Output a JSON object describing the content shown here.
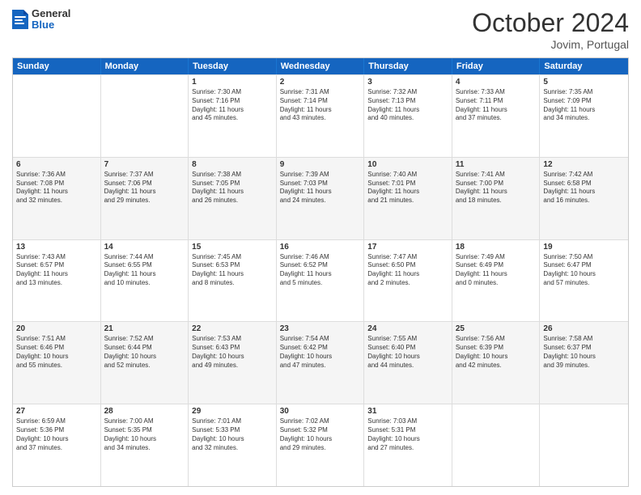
{
  "header": {
    "logo_general": "General",
    "logo_blue": "Blue",
    "month_title": "October 2024",
    "location": "Jovim, Portugal"
  },
  "weekdays": [
    "Sunday",
    "Monday",
    "Tuesday",
    "Wednesday",
    "Thursday",
    "Friday",
    "Saturday"
  ],
  "rows": [
    [
      {
        "day": "",
        "lines": [],
        "empty": true
      },
      {
        "day": "",
        "lines": [],
        "empty": true
      },
      {
        "day": "1",
        "lines": [
          "Sunrise: 7:30 AM",
          "Sunset: 7:16 PM",
          "Daylight: 11 hours",
          "and 45 minutes."
        ]
      },
      {
        "day": "2",
        "lines": [
          "Sunrise: 7:31 AM",
          "Sunset: 7:14 PM",
          "Daylight: 11 hours",
          "and 43 minutes."
        ]
      },
      {
        "day": "3",
        "lines": [
          "Sunrise: 7:32 AM",
          "Sunset: 7:13 PM",
          "Daylight: 11 hours",
          "and 40 minutes."
        ]
      },
      {
        "day": "4",
        "lines": [
          "Sunrise: 7:33 AM",
          "Sunset: 7:11 PM",
          "Daylight: 11 hours",
          "and 37 minutes."
        ]
      },
      {
        "day": "5",
        "lines": [
          "Sunrise: 7:35 AM",
          "Sunset: 7:09 PM",
          "Daylight: 11 hours",
          "and 34 minutes."
        ]
      }
    ],
    [
      {
        "day": "6",
        "lines": [
          "Sunrise: 7:36 AM",
          "Sunset: 7:08 PM",
          "Daylight: 11 hours",
          "and 32 minutes."
        ]
      },
      {
        "day": "7",
        "lines": [
          "Sunrise: 7:37 AM",
          "Sunset: 7:06 PM",
          "Daylight: 11 hours",
          "and 29 minutes."
        ]
      },
      {
        "day": "8",
        "lines": [
          "Sunrise: 7:38 AM",
          "Sunset: 7:05 PM",
          "Daylight: 11 hours",
          "and 26 minutes."
        ]
      },
      {
        "day": "9",
        "lines": [
          "Sunrise: 7:39 AM",
          "Sunset: 7:03 PM",
          "Daylight: 11 hours",
          "and 24 minutes."
        ]
      },
      {
        "day": "10",
        "lines": [
          "Sunrise: 7:40 AM",
          "Sunset: 7:01 PM",
          "Daylight: 11 hours",
          "and 21 minutes."
        ]
      },
      {
        "day": "11",
        "lines": [
          "Sunrise: 7:41 AM",
          "Sunset: 7:00 PM",
          "Daylight: 11 hours",
          "and 18 minutes."
        ]
      },
      {
        "day": "12",
        "lines": [
          "Sunrise: 7:42 AM",
          "Sunset: 6:58 PM",
          "Daylight: 11 hours",
          "and 16 minutes."
        ]
      }
    ],
    [
      {
        "day": "13",
        "lines": [
          "Sunrise: 7:43 AM",
          "Sunset: 6:57 PM",
          "Daylight: 11 hours",
          "and 13 minutes."
        ]
      },
      {
        "day": "14",
        "lines": [
          "Sunrise: 7:44 AM",
          "Sunset: 6:55 PM",
          "Daylight: 11 hours",
          "and 10 minutes."
        ]
      },
      {
        "day": "15",
        "lines": [
          "Sunrise: 7:45 AM",
          "Sunset: 6:53 PM",
          "Daylight: 11 hours",
          "and 8 minutes."
        ]
      },
      {
        "day": "16",
        "lines": [
          "Sunrise: 7:46 AM",
          "Sunset: 6:52 PM",
          "Daylight: 11 hours",
          "and 5 minutes."
        ]
      },
      {
        "day": "17",
        "lines": [
          "Sunrise: 7:47 AM",
          "Sunset: 6:50 PM",
          "Daylight: 11 hours",
          "and 2 minutes."
        ]
      },
      {
        "day": "18",
        "lines": [
          "Sunrise: 7:49 AM",
          "Sunset: 6:49 PM",
          "Daylight: 11 hours",
          "and 0 minutes."
        ]
      },
      {
        "day": "19",
        "lines": [
          "Sunrise: 7:50 AM",
          "Sunset: 6:47 PM",
          "Daylight: 10 hours",
          "and 57 minutes."
        ]
      }
    ],
    [
      {
        "day": "20",
        "lines": [
          "Sunrise: 7:51 AM",
          "Sunset: 6:46 PM",
          "Daylight: 10 hours",
          "and 55 minutes."
        ]
      },
      {
        "day": "21",
        "lines": [
          "Sunrise: 7:52 AM",
          "Sunset: 6:44 PM",
          "Daylight: 10 hours",
          "and 52 minutes."
        ]
      },
      {
        "day": "22",
        "lines": [
          "Sunrise: 7:53 AM",
          "Sunset: 6:43 PM",
          "Daylight: 10 hours",
          "and 49 minutes."
        ]
      },
      {
        "day": "23",
        "lines": [
          "Sunrise: 7:54 AM",
          "Sunset: 6:42 PM",
          "Daylight: 10 hours",
          "and 47 minutes."
        ]
      },
      {
        "day": "24",
        "lines": [
          "Sunrise: 7:55 AM",
          "Sunset: 6:40 PM",
          "Daylight: 10 hours",
          "and 44 minutes."
        ]
      },
      {
        "day": "25",
        "lines": [
          "Sunrise: 7:56 AM",
          "Sunset: 6:39 PM",
          "Daylight: 10 hours",
          "and 42 minutes."
        ]
      },
      {
        "day": "26",
        "lines": [
          "Sunrise: 7:58 AM",
          "Sunset: 6:37 PM",
          "Daylight: 10 hours",
          "and 39 minutes."
        ]
      }
    ],
    [
      {
        "day": "27",
        "lines": [
          "Sunrise: 6:59 AM",
          "Sunset: 5:36 PM",
          "Daylight: 10 hours",
          "and 37 minutes."
        ]
      },
      {
        "day": "28",
        "lines": [
          "Sunrise: 7:00 AM",
          "Sunset: 5:35 PM",
          "Daylight: 10 hours",
          "and 34 minutes."
        ]
      },
      {
        "day": "29",
        "lines": [
          "Sunrise: 7:01 AM",
          "Sunset: 5:33 PM",
          "Daylight: 10 hours",
          "and 32 minutes."
        ]
      },
      {
        "day": "30",
        "lines": [
          "Sunrise: 7:02 AM",
          "Sunset: 5:32 PM",
          "Daylight: 10 hours",
          "and 29 minutes."
        ]
      },
      {
        "day": "31",
        "lines": [
          "Sunrise: 7:03 AM",
          "Sunset: 5:31 PM",
          "Daylight: 10 hours",
          "and 27 minutes."
        ]
      },
      {
        "day": "",
        "lines": [],
        "empty": true
      },
      {
        "day": "",
        "lines": [],
        "empty": true
      }
    ]
  ]
}
